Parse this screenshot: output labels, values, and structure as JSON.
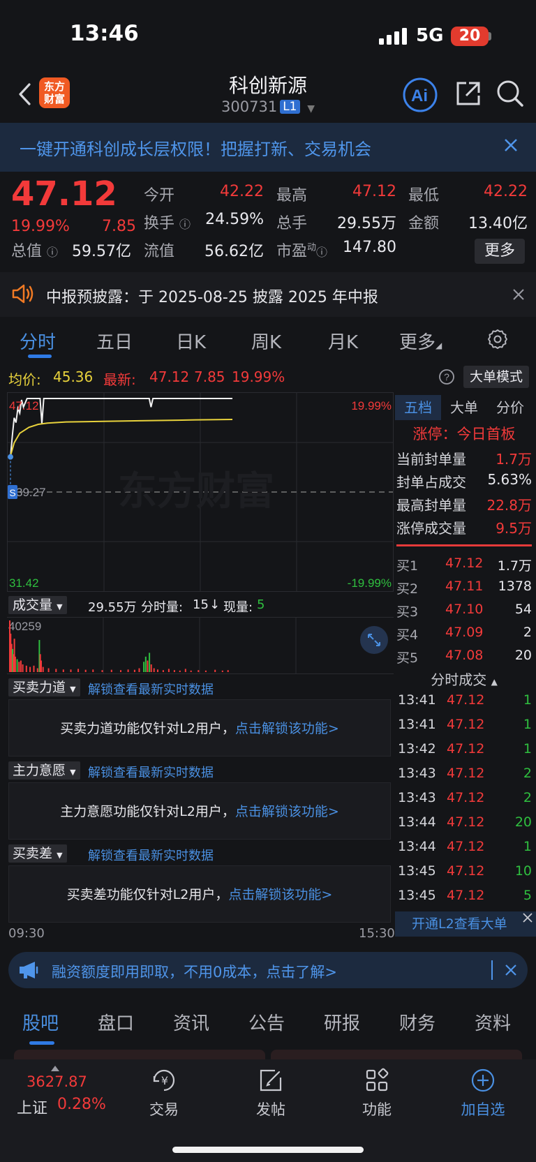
{
  "status_bar": {
    "time": "13:46",
    "network": "5G",
    "battery": "20"
  },
  "header": {
    "logo_line1": "东方",
    "logo_line2": "财富",
    "title": "科创新源",
    "code": "300731",
    "level": "L1"
  },
  "promo_banner": {
    "text": "一键开通科创成长层权限！把握打新、交易机会"
  },
  "quote": {
    "price": "47.12",
    "change_pct": "19.99%",
    "change": "7.85",
    "fields": [
      {
        "label": "今开",
        "value": "42.22",
        "color": "red"
      },
      {
        "label": "最高",
        "value": "47.12",
        "color": "red"
      },
      {
        "label": "最低",
        "value": "42.22",
        "color": "red"
      },
      {
        "label": "换手",
        "value": "24.59%",
        "color": "white"
      },
      {
        "label": "总手",
        "value": "29.55万",
        "color": "white"
      },
      {
        "label": "金额",
        "value": "13.40亿",
        "color": "white"
      },
      {
        "label": "总值",
        "value": "59.57亿",
        "color": "white"
      },
      {
        "label": "流值",
        "value": "56.62亿",
        "color": "white"
      },
      {
        "label": "市盈",
        "value": "147.80",
        "color": "white",
        "superscript": "动"
      }
    ],
    "more_label": "更多"
  },
  "notice": {
    "text": "中报预披露：于 2025-08-25 披露 2025 年中报"
  },
  "chart_tabs": [
    "分时",
    "五日",
    "日K",
    "周K",
    "月K",
    "更多"
  ],
  "chart_info": {
    "avg_label": "均价:",
    "avg_value": "45.36",
    "latest_label": "最新:",
    "latest_value": "47.12",
    "latest_change": "7.85",
    "latest_pct": "19.99%",
    "bigorder_label": "大单模式"
  },
  "chart_data": {
    "type": "line",
    "y_top_price": "47.12",
    "y_mid_price": "39.27",
    "y_bottom_price": "31.42",
    "y_top_pct": "19.99%",
    "y_bottom_pct": "-19.99%",
    "x_start": "09:30",
    "x_end": "15:30",
    "watermark": "东方财富",
    "marker": "S",
    "ylim": [
      31.42,
      47.12
    ],
    "series": [
      {
        "name": "price",
        "x": [
          0,
          2,
          4,
          6,
          8,
          10,
          12,
          14,
          18,
          22,
          28,
          32,
          34,
          36,
          38,
          40,
          60,
          80,
          100,
          140,
          150,
          152,
          154,
          200,
          240
        ],
        "values": [
          42.22,
          44.0,
          45.5,
          45.1,
          46.3,
          45.9,
          47.0,
          46.4,
          47.12,
          47.12,
          47.12,
          47.12,
          45.0,
          47.12,
          47.12,
          47.12,
          47.12,
          47.12,
          47.12,
          47.12,
          47.12,
          46.4,
          47.12,
          47.12,
          47.12
        ]
      },
      {
        "name": "average",
        "x": [
          0,
          4,
          10,
          20,
          30,
          40,
          60,
          100,
          140,
          180,
          200,
          240
        ],
        "values": [
          42.3,
          43.4,
          44.2,
          44.7,
          44.95,
          45.05,
          45.15,
          45.2,
          45.25,
          45.3,
          45.33,
          45.36
        ]
      }
    ],
    "volume": {
      "max_label": "40259",
      "bars": [
        {
          "x": 0,
          "v": 40259,
          "c": "red"
        },
        {
          "x": 1,
          "v": 30000,
          "c": "red"
        },
        {
          "x": 2,
          "v": 22000,
          "c": "red"
        },
        {
          "x": 3,
          "v": 18000,
          "c": "green"
        },
        {
          "x": 4,
          "v": 14000,
          "c": "red"
        },
        {
          "x": 5,
          "v": 26000,
          "c": "red"
        },
        {
          "x": 6,
          "v": 12000,
          "c": "red"
        },
        {
          "x": 8,
          "v": 10000,
          "c": "green"
        },
        {
          "x": 10,
          "v": 8000,
          "c": "red"
        },
        {
          "x": 12,
          "v": 9000,
          "c": "red"
        },
        {
          "x": 14,
          "v": 6000,
          "c": "red"
        },
        {
          "x": 18,
          "v": 5000,
          "c": "red"
        },
        {
          "x": 22,
          "v": 4000,
          "c": "red"
        },
        {
          "x": 26,
          "v": 5000,
          "c": "red"
        },
        {
          "x": 30,
          "v": 3000,
          "c": "red"
        },
        {
          "x": 32,
          "v": 25000,
          "c": "green"
        },
        {
          "x": 33,
          "v": 14000,
          "c": "red"
        },
        {
          "x": 34,
          "v": 9000,
          "c": "red"
        },
        {
          "x": 36,
          "v": 4000,
          "c": "red"
        },
        {
          "x": 42,
          "v": 3000,
          "c": "red"
        },
        {
          "x": 50,
          "v": 2500,
          "c": "red"
        },
        {
          "x": 58,
          "v": 2000,
          "c": "red"
        },
        {
          "x": 66,
          "v": 2000,
          "c": "red"
        },
        {
          "x": 74,
          "v": 2500,
          "c": "red"
        },
        {
          "x": 82,
          "v": 1800,
          "c": "red"
        },
        {
          "x": 90,
          "v": 2000,
          "c": "red"
        },
        {
          "x": 100,
          "v": 1500,
          "c": "red"
        },
        {
          "x": 110,
          "v": 1800,
          "c": "red"
        },
        {
          "x": 120,
          "v": 1500,
          "c": "red"
        },
        {
          "x": 128,
          "v": 2000,
          "c": "red"
        },
        {
          "x": 135,
          "v": 1800,
          "c": "red"
        },
        {
          "x": 140,
          "v": 3000,
          "c": "red"
        },
        {
          "x": 145,
          "v": 8000,
          "c": "green"
        },
        {
          "x": 147,
          "v": 12000,
          "c": "green"
        },
        {
          "x": 149,
          "v": 9000,
          "c": "red"
        },
        {
          "x": 151,
          "v": 15000,
          "c": "green"
        },
        {
          "x": 153,
          "v": 6000,
          "c": "red"
        },
        {
          "x": 156,
          "v": 3000,
          "c": "red"
        },
        {
          "x": 160,
          "v": 2000,
          "c": "red"
        },
        {
          "x": 166,
          "v": 1500,
          "c": "red"
        },
        {
          "x": 172,
          "v": 2500,
          "c": "red"
        },
        {
          "x": 178,
          "v": 1500,
          "c": "red"
        },
        {
          "x": 184,
          "v": 1200,
          "c": "red"
        },
        {
          "x": 190,
          "v": 2500,
          "c": "red"
        },
        {
          "x": 196,
          "v": 1200,
          "c": "red"
        },
        {
          "x": 204,
          "v": 1500,
          "c": "red"
        },
        {
          "x": 212,
          "v": 1200,
          "c": "red"
        },
        {
          "x": 222,
          "v": 1800,
          "c": "red"
        },
        {
          "x": 230,
          "v": 1200,
          "c": "red"
        },
        {
          "x": 236,
          "v": 1500,
          "c": "red"
        }
      ]
    }
  },
  "volume_row": {
    "select": "成交量",
    "total": "29.55万",
    "minute_label": "分时量:",
    "minute_value": "15",
    "arrow": "↓",
    "now_label": "现量:",
    "now_value": "5"
  },
  "locked_sections": [
    {
      "select": "买卖力道",
      "hint": "解锁查看最新实时数据",
      "panel": "买卖力道功能仅针对L2用户，",
      "link": "点击解锁该功能>"
    },
    {
      "select": "主力意愿",
      "hint": "解锁查看最新实时数据",
      "panel": "主力意愿功能仅针对L2用户，",
      "link": "点击解锁该功能>"
    },
    {
      "select": "买卖差",
      "hint": "解锁查看最新实时数据",
      "panel": "买卖差功能仅针对L2用户，",
      "link": "点击解锁该功能>"
    }
  ],
  "right_panel": {
    "tabs": [
      "五档",
      "大单",
      "分价"
    ],
    "limit_title": "涨停：今日首板",
    "limit_rows": [
      {
        "label": "当前封单量",
        "value": "1.7万",
        "color": "red"
      },
      {
        "label": "封单占成交",
        "value": "5.63%",
        "color": "white"
      },
      {
        "label": "最高封单量",
        "value": "22.8万",
        "color": "red"
      },
      {
        "label": "涨停成交量",
        "value": "9.5万",
        "color": "red"
      }
    ],
    "book": [
      {
        "label": "买1",
        "price": "47.12",
        "qty": "1.7万"
      },
      {
        "label": "买2",
        "price": "47.11",
        "qty": "1378"
      },
      {
        "label": "买3",
        "price": "47.10",
        "qty": "54"
      },
      {
        "label": "买4",
        "price": "47.09",
        "qty": "2"
      },
      {
        "label": "买5",
        "price": "47.08",
        "qty": "20"
      }
    ],
    "ticks_title": "分时成交",
    "ticks": [
      {
        "time": "13:41",
        "price": "47.12",
        "vol": "1"
      },
      {
        "time": "13:41",
        "price": "47.12",
        "vol": "1"
      },
      {
        "time": "13:42",
        "price": "47.12",
        "vol": "1"
      },
      {
        "time": "13:43",
        "price": "47.12",
        "vol": "2"
      },
      {
        "time": "13:43",
        "price": "47.12",
        "vol": "2"
      },
      {
        "time": "13:44",
        "price": "47.12",
        "vol": "20"
      },
      {
        "time": "13:44",
        "price": "47.12",
        "vol": "1"
      },
      {
        "time": "13:45",
        "price": "47.12",
        "vol": "10"
      },
      {
        "time": "13:45",
        "price": "47.12",
        "vol": "5"
      }
    ],
    "l2_bar": "开通L2查看大单"
  },
  "finance_bar": {
    "text": "融资额度即用即取，不用0成本，点击了解>"
  },
  "info_tabs": [
    "股吧",
    "盘口",
    "资讯",
    "公告",
    "研报",
    "财务",
    "资料"
  ],
  "bottom_nav": {
    "index_value": "3627.87",
    "index_name": "上证",
    "index_pct": "0.28%",
    "items": [
      {
        "label": "交易",
        "icon": "trade-icon"
      },
      {
        "label": "发帖",
        "icon": "post-icon"
      },
      {
        "label": "功能",
        "icon": "function-icon"
      },
      {
        "label": "加自选",
        "icon": "add-watchlist-icon"
      }
    ]
  },
  "colors": {
    "up": "#f23a3a",
    "down": "#2fbf3f",
    "accent": "#4a90e2",
    "avg_line": "#e8d23c",
    "background": "#141518"
  }
}
